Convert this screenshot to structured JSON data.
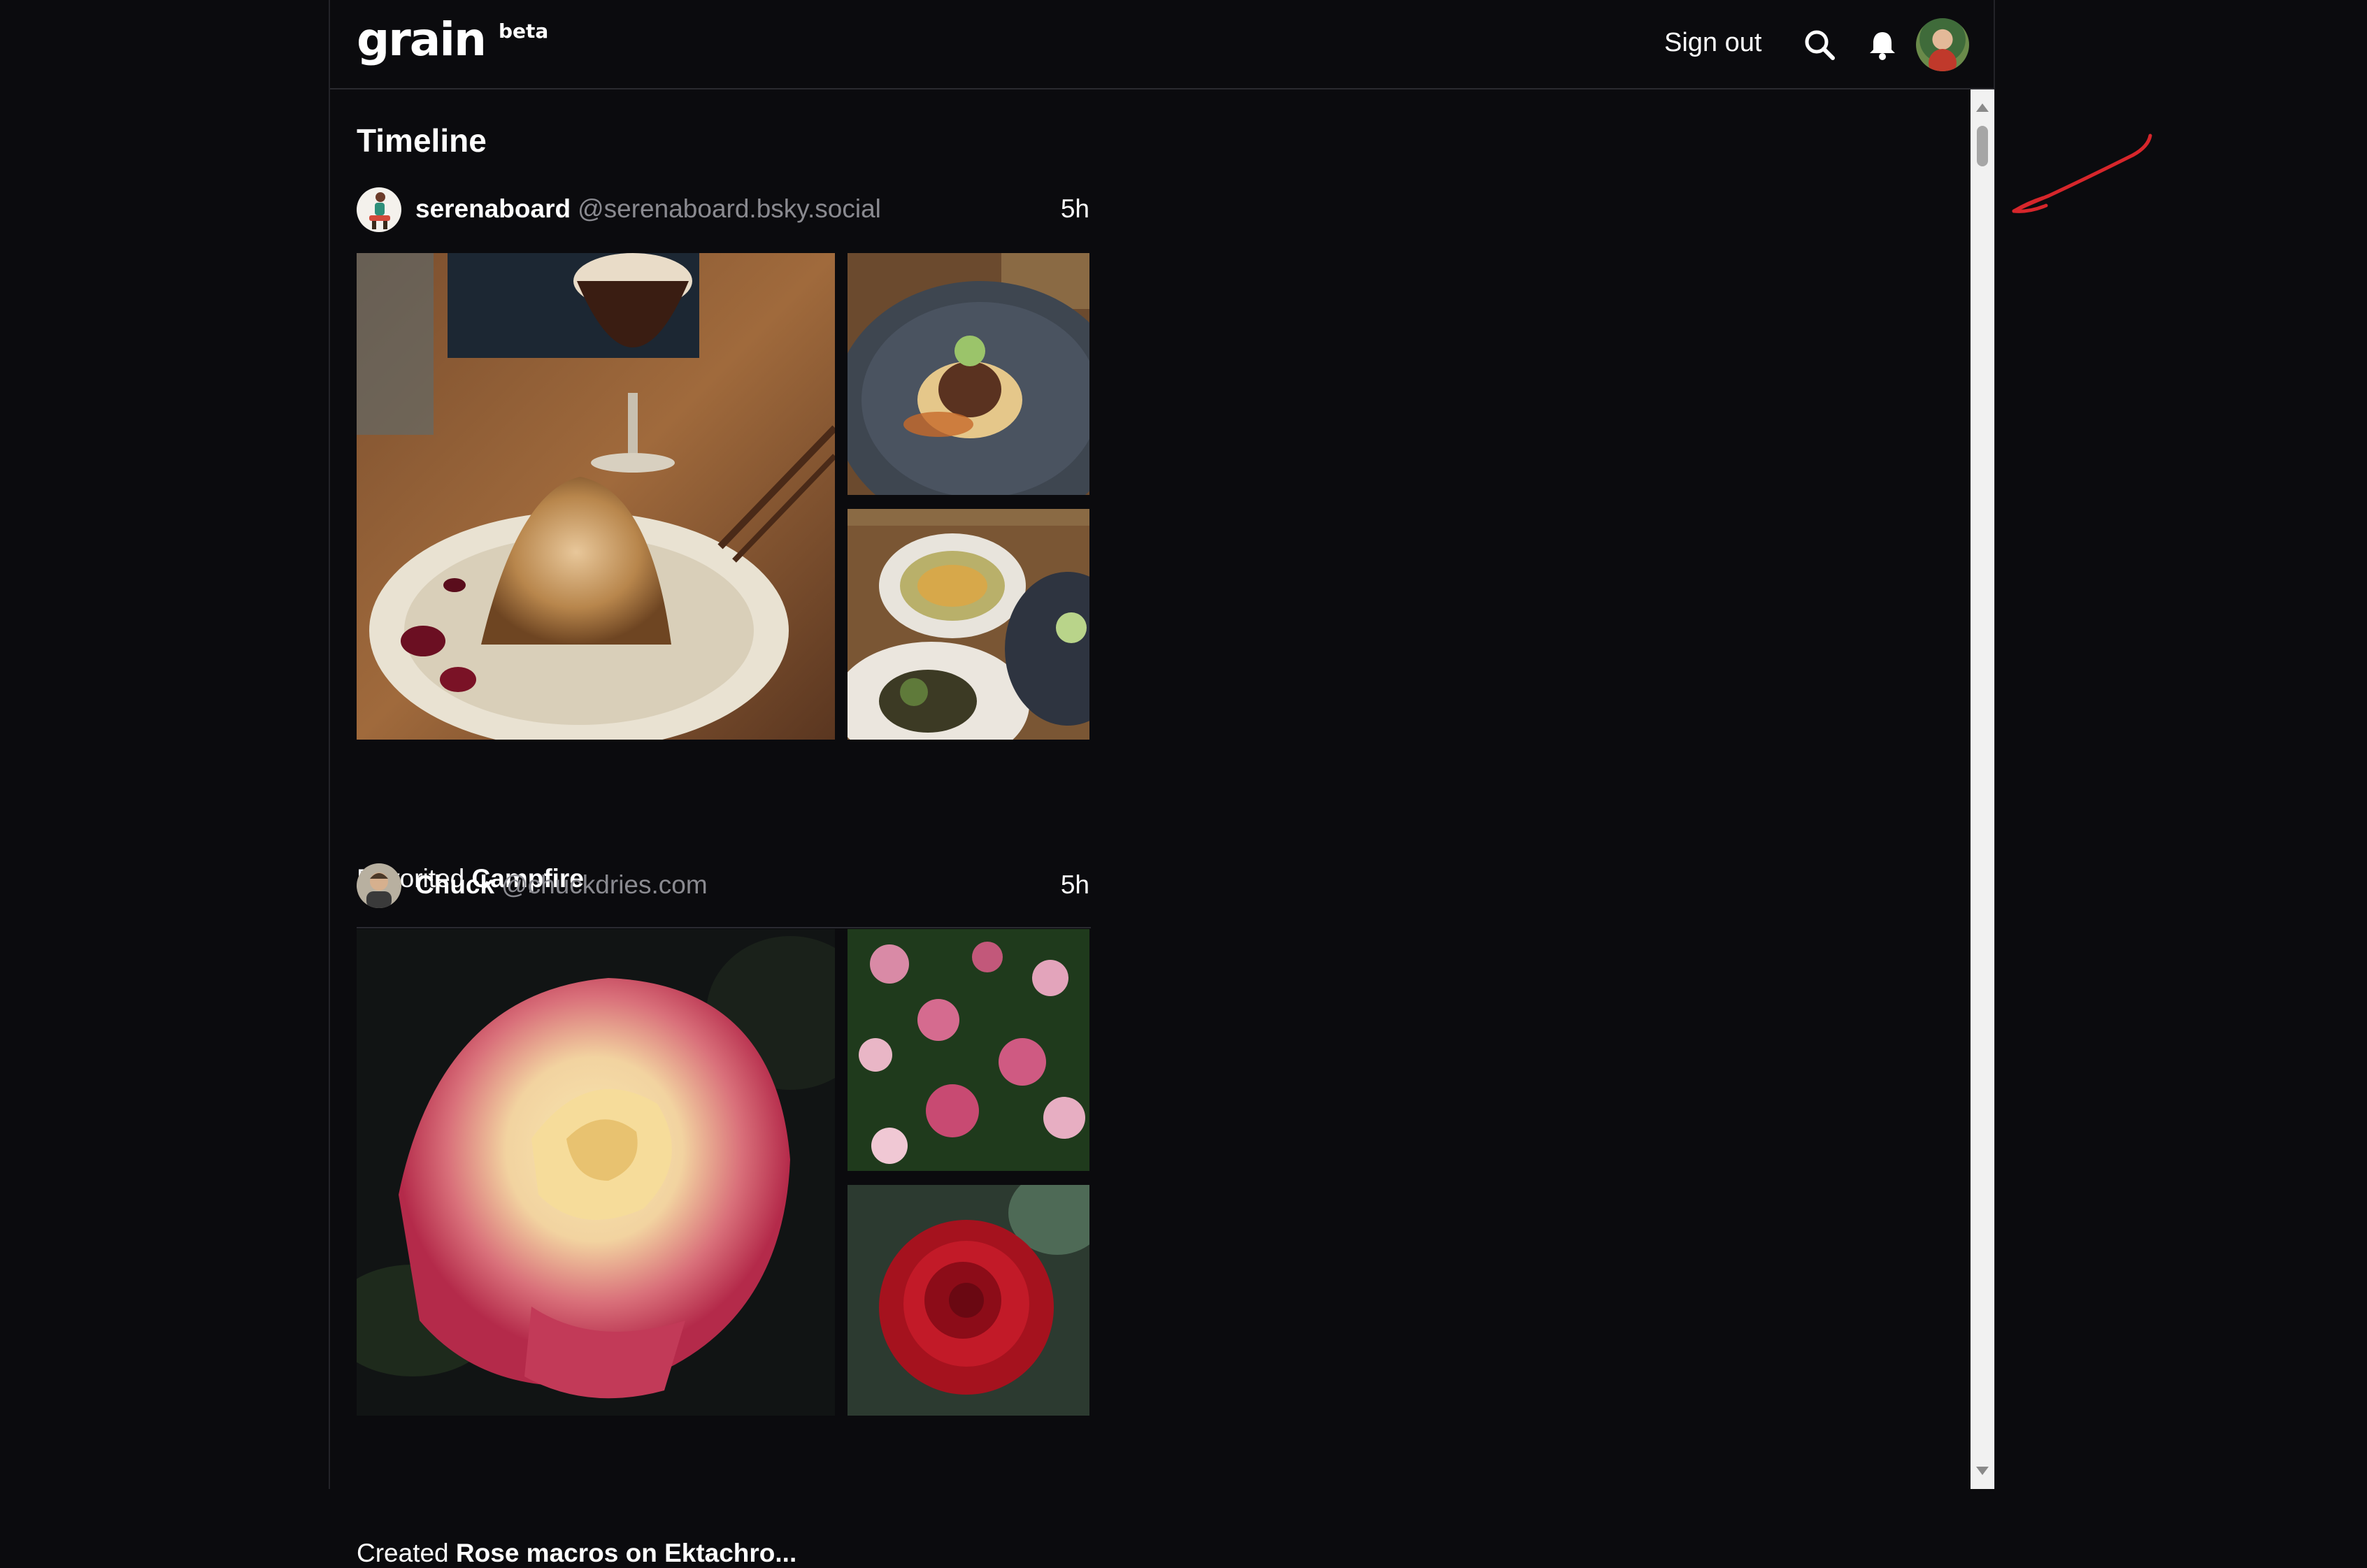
{
  "header": {
    "logo": "grain",
    "logo_badge": "beta",
    "sign_out_label": "Sign out"
  },
  "timeline": {
    "title": "Timeline"
  },
  "posts": [
    {
      "display_name": "serenaboard",
      "handle": "@serenaboard.bsky.social",
      "time": "5h",
      "action": "Favorited",
      "gallery_title": "Campfire"
    },
    {
      "display_name": "Chuck",
      "handle": "@chuckdries.com",
      "time": "5h",
      "action": "Created",
      "gallery_title": "Rose macros on Ektachro..."
    }
  ],
  "icons": {
    "search": "search-icon",
    "notifications": "bell-icon",
    "profile": "user-avatar"
  },
  "colors": {
    "background": "#0b0b0e",
    "text": "#ffffff",
    "handle": "#8a8a90",
    "annotation": "#d7262b"
  }
}
